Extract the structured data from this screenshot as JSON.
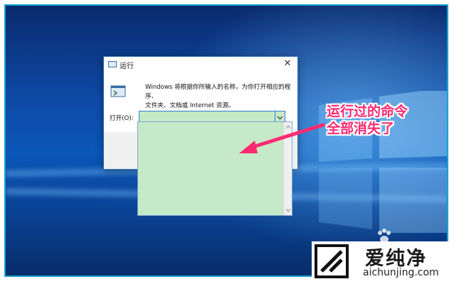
{
  "dialog": {
    "title": "运行",
    "description_line1": "Windows 将根据你所输入的名称，为你打开相应的程序、",
    "description_line2": "文件夹、文档或 Internet 资源。",
    "open_label": "打开(O):",
    "open_value": ""
  },
  "annotation": {
    "line1": "运行过的命令",
    "line2": "全部消失了",
    "color": "#ff2a72"
  },
  "watermark": {
    "brand_cn": "爱纯净",
    "brand_en": "aichunjing.com"
  },
  "colors": {
    "frame_border": "#16a3d4",
    "input_bg": "#c6e9c7",
    "desktop": "#0b56b8"
  }
}
